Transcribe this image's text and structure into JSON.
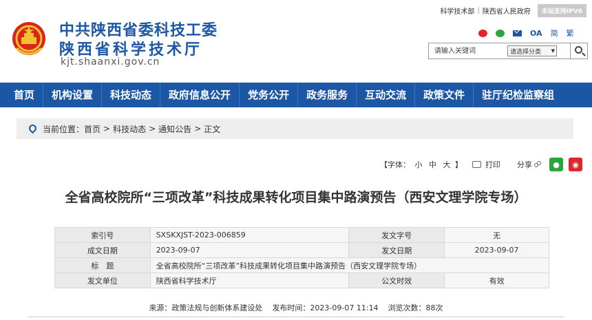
{
  "header": {
    "title_line1": "中共陕西省委科技工委",
    "title_line2": "陕西省科学技术厅",
    "domain": "kjt.shaanxi.gov.cn",
    "top_links": [
      "科学技术部",
      "陕西省人民政府"
    ],
    "ipv6_badge": "本站支持IPV6",
    "icon_oa": "OA",
    "lang_simplified": "简",
    "lang_traditional": "繁",
    "search_placeholder": "请输入关键词",
    "search_category": "请选择分类"
  },
  "nav": {
    "items": [
      "首页",
      "机构设置",
      "科技动态",
      "政府信息公开",
      "党务公开",
      "政务服务",
      "互动交流",
      "政策文件",
      "驻厅纪检监察组"
    ]
  },
  "breadcrumb": {
    "prefix": "当前位置：",
    "items": [
      "首页",
      "科技动态",
      "通知公告",
      "正文"
    ],
    "separator": ">"
  },
  "tools": {
    "font_open": "【字体：",
    "font_small": "小",
    "font_medium": "中",
    "font_large": "大",
    "font_close": "】",
    "print": "打印",
    "share": "分享"
  },
  "article": {
    "title": "全省高校院所“三项改革”科技成果转化项目集中路演预告（西安文理学院专场）",
    "meta": {
      "index_label": "索引号",
      "index_value": "SXSKXJST-2023-006859",
      "doc_no_label": "发文字号",
      "doc_no_value": "无",
      "created_label": "成文日期",
      "created_value": "2023-09-07",
      "issued_label": "发文日期",
      "issued_value": "2023-09-07",
      "subject_label": "标　题",
      "subject_value": "全省高校院所“三项改革”科技成果转化项目集中路演预告（西安文理学院专场）",
      "issuer_label": "发文单位",
      "issuer_value": "陕西省科学技术厅",
      "validity_label": "公文时效",
      "validity_value": "有效"
    },
    "source": "来源：政策法规与创新体系建设处",
    "publish_time": "发布时间：2023-09-07 11:14",
    "views": "浏览次数：88次"
  },
  "colors": {
    "brand_blue": "#1c57a5",
    "weibo_red": "#e0262b",
    "wechat_green": "#2aa63c"
  }
}
